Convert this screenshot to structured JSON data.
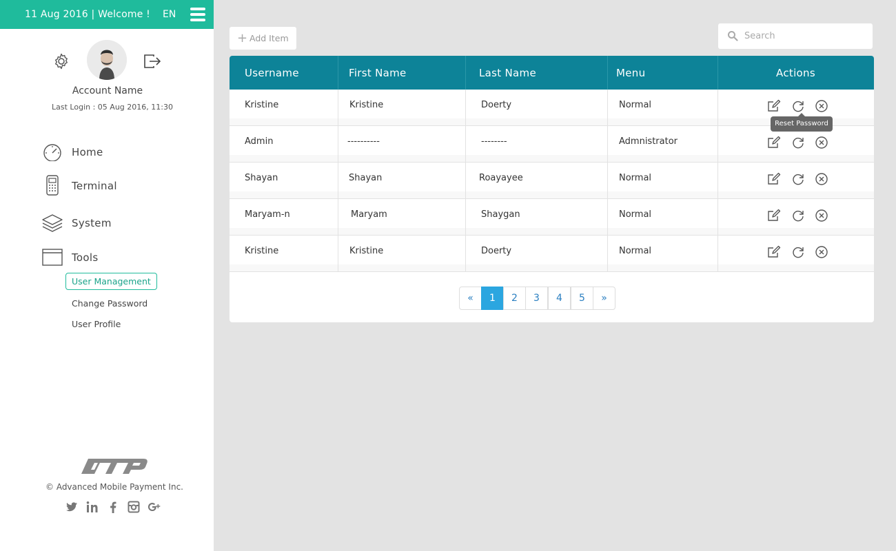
{
  "header": {
    "date_welcome": "11 Aug 2016 | Welcome !",
    "language": "EN"
  },
  "profile": {
    "account_name": "Account Name",
    "last_login": "Last Login : 05 Aug 2016, 11:30"
  },
  "nav": {
    "items": [
      {
        "label": "Home",
        "icon": "dashboard-icon"
      },
      {
        "label": "Terminal",
        "icon": "terminal-icon"
      },
      {
        "label": "System",
        "icon": "layers-icon"
      },
      {
        "label": "Tools",
        "icon": "window-icon"
      }
    ],
    "sub_items": [
      {
        "label": "User Management",
        "active": true
      },
      {
        "label": "Change Password",
        "active": false
      },
      {
        "label": "User Profile",
        "active": false
      }
    ]
  },
  "footer": {
    "logo_text": "AMP",
    "copyright": "© Advanced Mobile Payment Inc.",
    "social": [
      "twitter-icon",
      "linkedin-icon",
      "facebook-icon",
      "instagram-icon",
      "google-plus-icon"
    ]
  },
  "toolbar": {
    "add_item_label": "Add Item",
    "search_placeholder": "Search"
  },
  "table": {
    "columns": [
      "Username",
      "First Name",
      "Last Name",
      "Menu",
      "Actions"
    ],
    "rows": [
      {
        "username": "Kristine",
        "first_name": "Kristine",
        "last_name": "Doerty",
        "menu": "Normal"
      },
      {
        "username": "Admin",
        "first_name": "----------",
        "last_name": "--------",
        "menu": "Admnistrator"
      },
      {
        "username": "Shayan",
        "first_name": "Shayan",
        "last_name": "Roayayee",
        "menu": "Normal"
      },
      {
        "username": "Maryam-n",
        "first_name": "Maryam",
        "last_name": "Shaygan",
        "menu": "Normal"
      },
      {
        "username": "Kristine",
        "first_name": "Kristine",
        "last_name": "Doerty",
        "menu": "Normal"
      }
    ],
    "tooltip": "Reset Password"
  },
  "pagination": {
    "prev": "«",
    "pages": [
      "1",
      "2",
      "3",
      "4",
      "5"
    ],
    "next": "»",
    "current": "1"
  },
  "colors": {
    "accent": "#1fbb9c",
    "table_header": "#0d8398",
    "page_active": "#2ba6e0"
  }
}
